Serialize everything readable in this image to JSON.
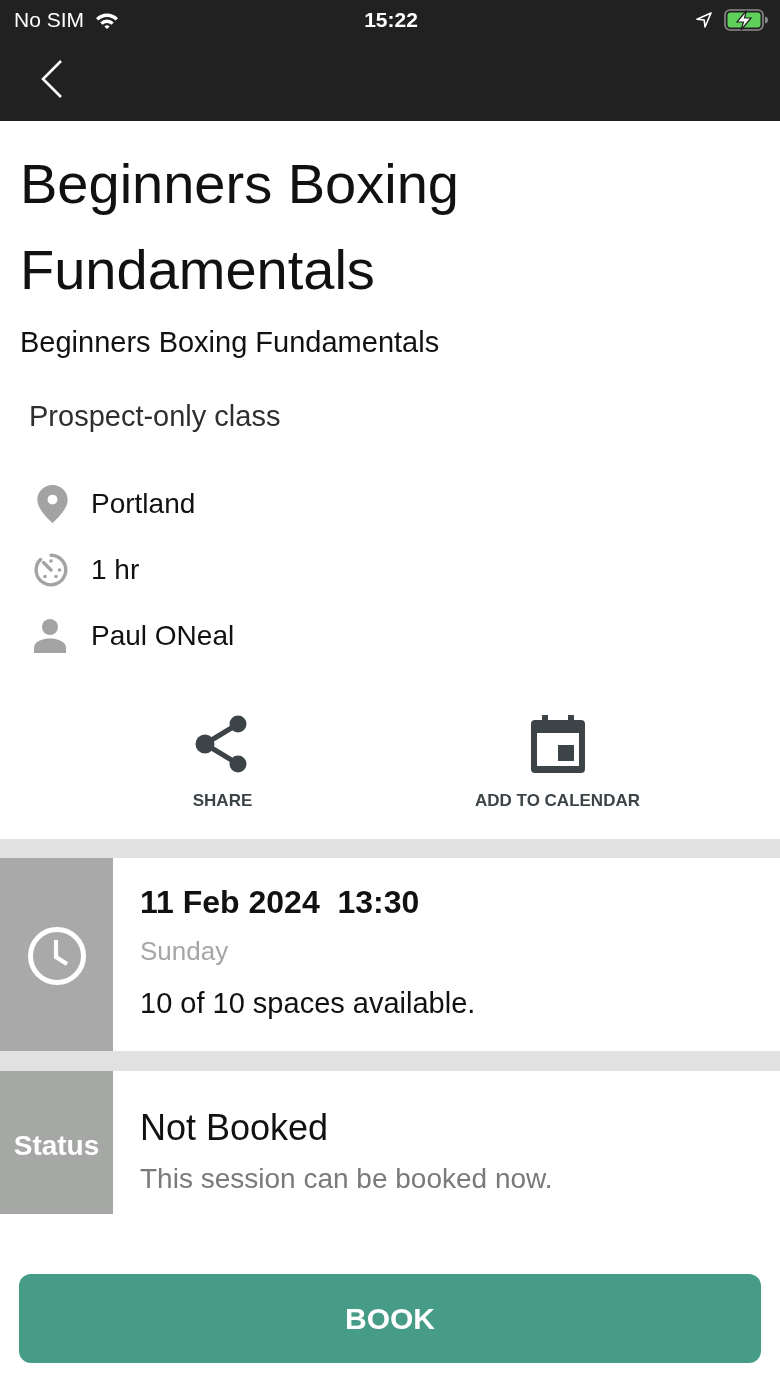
{
  "status_bar": {
    "carrier": "No SIM",
    "time": "15:22",
    "charging": true
  },
  "class": {
    "title": "Beginners Boxing Fundamentals",
    "subtitle": "Beginners Boxing Fundamentals",
    "tag": "Prospect-only class",
    "details": [
      {
        "kind": "location",
        "text": "Portland"
      },
      {
        "kind": "duration",
        "text": "1 hr"
      },
      {
        "kind": "instructor",
        "text": "Paul ONeal"
      }
    ]
  },
  "actions": [
    {
      "kind": "share",
      "label": "SHARE"
    },
    {
      "kind": "calendar",
      "label": "ADD TO CALENDAR"
    }
  ],
  "session": {
    "date": "11 Feb 2024  13:30",
    "day": "Sunday",
    "availability": "10 of 10 spaces available."
  },
  "status": {
    "label": "Status",
    "title": "Not Booked",
    "description": "This session can be booked now."
  },
  "book_button": {
    "label": "BOOK"
  }
}
